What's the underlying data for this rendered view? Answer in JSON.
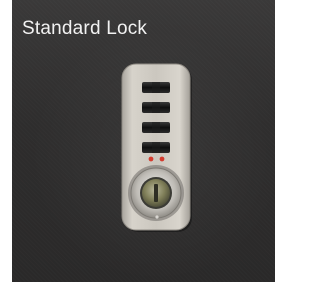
{
  "title": "Standard Lock",
  "colors": {
    "background": "#2e2d2d",
    "title_text": "#f2f2f2",
    "lock_plate": "#c9c5bd",
    "dial_dark": "#1d1d1d",
    "indicator_red": "#d43b2e",
    "key_cylinder": "#8a8a5a"
  },
  "lock": {
    "icon": "combination-lock-icon",
    "dials_count": 4
  }
}
